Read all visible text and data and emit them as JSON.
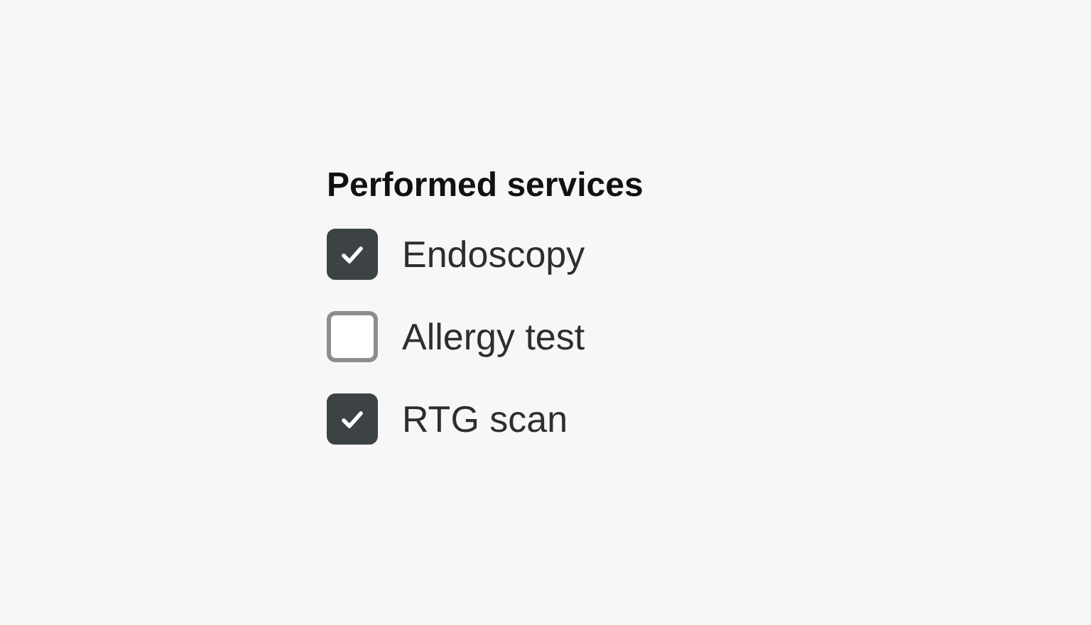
{
  "group": {
    "title": "Performed services",
    "options": [
      {
        "label": "Endoscopy",
        "checked": true
      },
      {
        "label": "Allergy test",
        "checked": false
      },
      {
        "label": "RTG scan",
        "checked": true
      }
    ]
  }
}
